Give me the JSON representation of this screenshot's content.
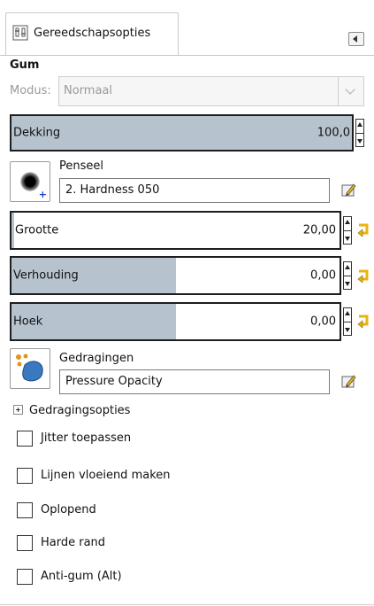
{
  "tab": {
    "label": "Gereedschapsopties",
    "icon": "tool-options-icon"
  },
  "tool": {
    "title": "Gum"
  },
  "modus": {
    "label": "Modus:",
    "value": "Normaal"
  },
  "dekking": {
    "label": "Dekking",
    "value": "100,0",
    "fraction": 1.0
  },
  "penseel": {
    "label": "Penseel",
    "value": "2. Hardness 050"
  },
  "grootte": {
    "label": "Grootte",
    "value": "20,00"
  },
  "verhouding": {
    "label": "Verhouding",
    "value": "0,00",
    "fraction": 0.5
  },
  "hoek": {
    "label": "Hoek",
    "value": "0,00",
    "fraction": 0.5
  },
  "gedragingen": {
    "label": "Gedragingen",
    "value": "Pressure Opacity"
  },
  "gedragingsopties": {
    "label": "Gedragingsopties"
  },
  "checkboxes": [
    {
      "label": "Jitter toepassen",
      "checked": false
    },
    {
      "label": "Lijnen vloeiend maken",
      "checked": false
    },
    {
      "label": "Oplopend",
      "checked": false
    },
    {
      "label": "Harde rand",
      "checked": false
    },
    {
      "label": "Anti-gum (Alt)",
      "checked": false
    }
  ],
  "colors": {
    "slider_fill": "#b6c3cf",
    "reset_icon": "#e8b40f",
    "dynamics_icon": "#3a78c0"
  }
}
